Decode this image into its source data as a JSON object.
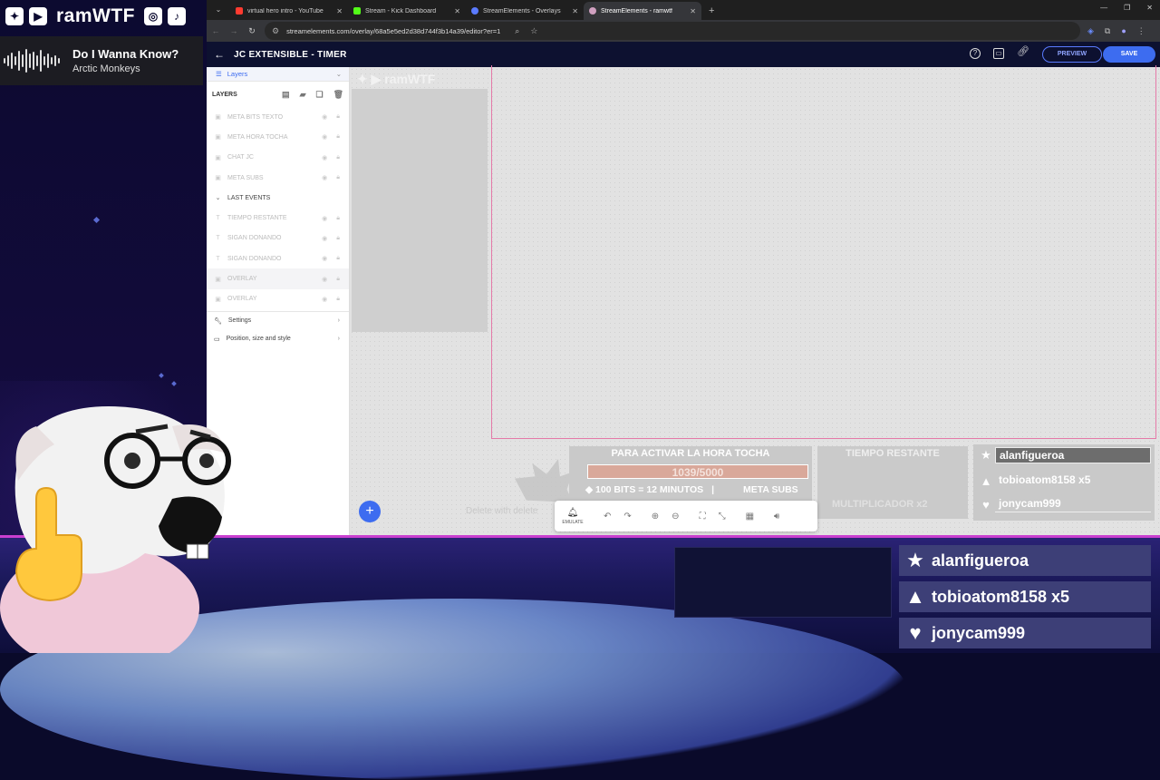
{
  "stream": {
    "channel_name": "ramWTF",
    "now_playing": {
      "title": "Do I Wanna Know?",
      "artist": "Arctic Monkeys"
    }
  },
  "browser": {
    "tabs": [
      {
        "title": "virtual hero intro - YouTube",
        "favicon_color": "#ff3b30"
      },
      {
        "title": "Stream - Kick Dashboard",
        "favicon_color": "#53fc18"
      },
      {
        "title": "StreamElements - Overlays",
        "favicon_color": "#5b7bff"
      },
      {
        "title": "StreamElements - ramwtf",
        "favicon_color": "#d0a0c0"
      }
    ],
    "active_tab": 3,
    "url": "streamelements.com/overlay/68a5e5ed2d38d744f3b14a39/editor?er=1"
  },
  "editor": {
    "title": "JC EXTENSIBLE - TIMER",
    "preview_label": "PREVIEW",
    "save_label": "SAVE",
    "sidebar": {
      "layers_tab": "Layers",
      "layers_heading": "LAYERS",
      "layers": [
        {
          "name": "META BITS TEXTO",
          "kind": "image"
        },
        {
          "name": "META HORA TOCHA",
          "kind": "image"
        },
        {
          "name": "CHAT JC",
          "kind": "image"
        },
        {
          "name": "META SUBS",
          "kind": "image"
        }
      ],
      "group": "LAST EVENTS",
      "group_layers": [
        {
          "name": "TIEMPO RESTANTE",
          "kind": "text"
        },
        {
          "name": "SIGAN DONANDO",
          "kind": "text"
        },
        {
          "name": "SIGAN DONANDO",
          "kind": "text"
        },
        {
          "name": "OVERLAY",
          "kind": "image"
        },
        {
          "name": "OVERLAY",
          "kind": "image"
        }
      ],
      "settings_label": "Settings",
      "position_label": "Position, size and style"
    },
    "canvas": {
      "meta_title": "PARA ACTIVAR LA HORA TOCHA",
      "meta_progress": "1039/5000",
      "meta_progress_fraction": 0.208,
      "bits_text": "100 BITS = 12 MINUTOS",
      "separator": "|",
      "subs_text": "META SUBS",
      "tiempo_title": "TIEMPO RESTANTE",
      "multiplicador": "MULTIPLICADOR x2",
      "delete_hint": "Delete with delete",
      "events": [
        {
          "icon": "star-icon",
          "name": "alanfigueroa"
        },
        {
          "icon": "diamond-icon",
          "name": "tobioatom8158  x5"
        },
        {
          "icon": "heart-icon",
          "name": "jonycam999"
        }
      ]
    },
    "toolbar": {
      "emulate_label": "EMULATE"
    }
  },
  "bottom_events": [
    {
      "icon": "star-icon",
      "name": "alanfigueroa"
    },
    {
      "icon": "diamond-icon",
      "name": "tobioatom8158  x5"
    },
    {
      "icon": "heart-icon",
      "name": "jonycam999"
    }
  ],
  "colors": {
    "accent_blue": "#3d6cf0",
    "overlay_purple": "#2a2275",
    "frame_pink": "#e47aa8",
    "editor_header": "#0d1130"
  }
}
